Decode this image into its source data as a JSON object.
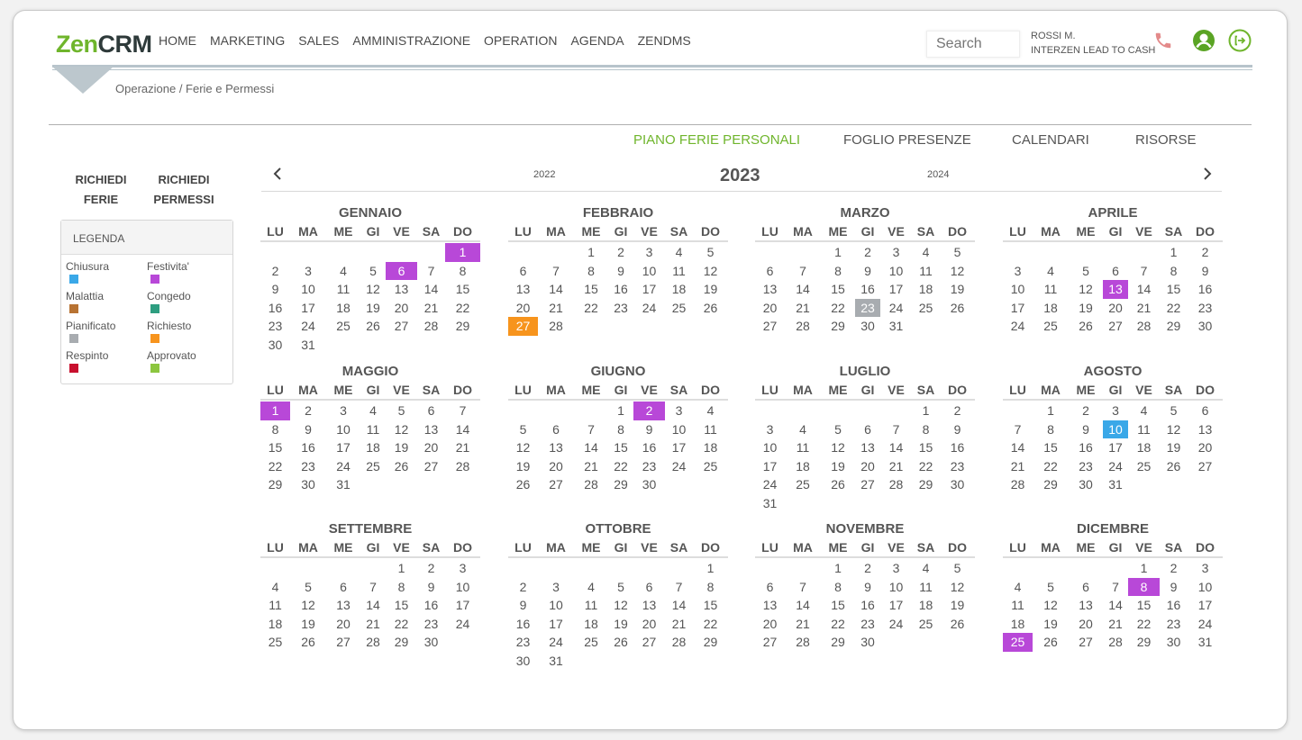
{
  "brand": {
    "part1": "Zen",
    "part2": "CRM"
  },
  "nav": [
    "HOME",
    "MARKETING",
    "SALES",
    "AMMINISTRAZIONE",
    "OPERATION",
    "AGENDA",
    "ZENDMS"
  ],
  "search": {
    "placeholder": "Search"
  },
  "user": {
    "name": "ROSSI M.",
    "company": "INTERZEN LEAD TO CASH"
  },
  "icons": {
    "phone": "phone-icon",
    "account": "user-circle-icon",
    "logout": "logout-icon"
  },
  "breadcrumb": "Operazione / Ferie e Permessi",
  "tabs": [
    {
      "label": "PIANO FERIE PERSONALI",
      "active": true
    },
    {
      "label": "FOGLIO PRESENZE",
      "active": false
    },
    {
      "label": "CALENDARI",
      "active": false
    },
    {
      "label": "RISORSE",
      "active": false
    }
  ],
  "actions": {
    "richiedi_ferie": {
      "line1": "RICHIEDI",
      "line2": "FERIE"
    },
    "richiedi_permessi": {
      "line1": "RICHIEDI",
      "line2": "PERMESSI"
    }
  },
  "legend": {
    "title": "LEGENDA",
    "items": [
      {
        "label": "Chiusura",
        "color": "#3aa8e8"
      },
      {
        "label": "Festivita'",
        "color": "#b848d8"
      },
      {
        "label": "Malattia",
        "color": "#b87333"
      },
      {
        "label": "Congedo",
        "color": "#2e9e80"
      },
      {
        "label": "Pianificato",
        "color": "#a8acb0"
      },
      {
        "label": "Richiesto",
        "color": "#f7941d"
      },
      {
        "label": "Respinto",
        "color": "#c8102e"
      },
      {
        "label": "Approvato",
        "color": "#8cc63f"
      }
    ]
  },
  "year_nav": {
    "prev": "2022",
    "current": "2023",
    "next": "2024",
    "prev_arrow": "chevron-left-icon",
    "next_arrow": "chevron-right-icon"
  },
  "weekdays": [
    "LU",
    "MA",
    "ME",
    "GI",
    "VE",
    "SA",
    "DO"
  ],
  "months": [
    {
      "name": "GENNAIO",
      "offset": 6,
      "days": 31,
      "marks": [
        {
          "day": 1,
          "color": "#b848d8"
        },
        {
          "day": 6,
          "color": "#b848d8"
        }
      ]
    },
    {
      "name": "FEBBRAIO",
      "offset": 2,
      "days": 28,
      "marks": [
        {
          "day": 27,
          "color": "#f7941d"
        }
      ]
    },
    {
      "name": "MARZO",
      "offset": 2,
      "days": 31,
      "marks": [
        {
          "day": 23,
          "color": "#a8acb0"
        }
      ]
    },
    {
      "name": "APRILE",
      "offset": 5,
      "days": 30,
      "marks": [
        {
          "day": 13,
          "color": "#b848d8"
        }
      ]
    },
    {
      "name": "MAGGIO",
      "offset": 0,
      "days": 31,
      "marks": [
        {
          "day": 1,
          "color": "#b848d8"
        }
      ]
    },
    {
      "name": "GIUGNO",
      "offset": 3,
      "days": 30,
      "marks": [
        {
          "day": 2,
          "color": "#b848d8"
        }
      ]
    },
    {
      "name": "LUGLIO",
      "offset": 5,
      "days": 31,
      "marks": []
    },
    {
      "name": "AGOSTO",
      "offset": 1,
      "days": 31,
      "marks": [
        {
          "day": 10,
          "color": "#3aa8e8"
        }
      ]
    },
    {
      "name": "SETTEMBRE",
      "offset": 4,
      "days": 30,
      "marks": []
    },
    {
      "name": "OTTOBRE",
      "offset": 6,
      "days": 31,
      "marks": []
    },
    {
      "name": "NOVEMBRE",
      "offset": 2,
      "days": 30,
      "marks": []
    },
    {
      "name": "DICEMBRE",
      "offset": 4,
      "days": 31,
      "marks": [
        {
          "day": 8,
          "color": "#b848d8"
        },
        {
          "day": 25,
          "color": "#b848d8"
        }
      ]
    }
  ]
}
